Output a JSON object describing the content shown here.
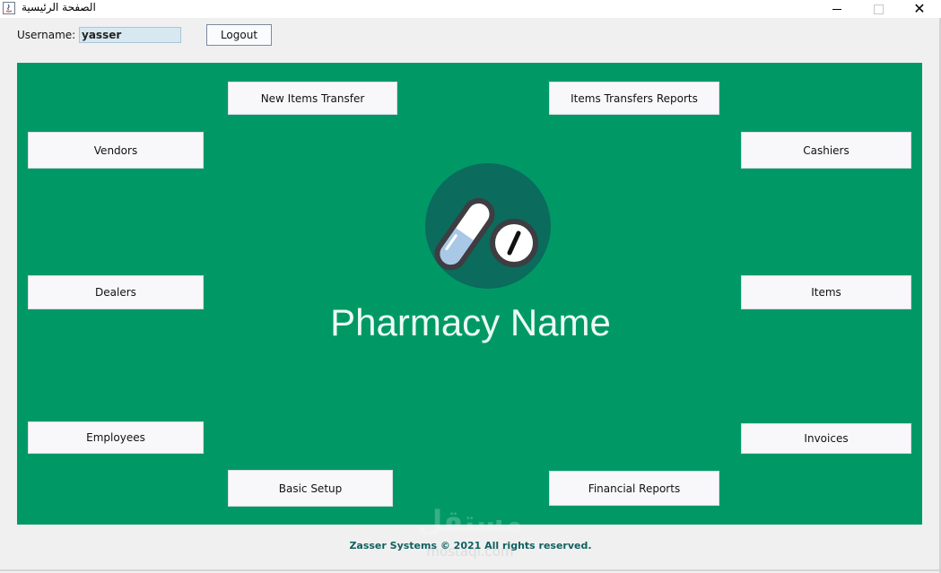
{
  "window": {
    "title": "الصفحة الرئيسية",
    "controls": {
      "minimize": "minimize-icon",
      "maximize": "maximize-icon",
      "close_glyph": "✕"
    }
  },
  "header": {
    "username_label": "Username:",
    "username_value": "yasser",
    "logout_label": "Logout"
  },
  "main": {
    "buttons": {
      "new_items_transfer": "New Items Transfer",
      "items_transfers_reports": "Items Transfers Reports",
      "vendors": "Vendors",
      "cashiers": "Cashiers",
      "dealers": "Dealers",
      "items": "Items",
      "employees": "Employees",
      "invoices": "Invoices",
      "basic_setup": "Basic Setup",
      "financial_reports": "Financial Reports"
    },
    "pharmacy_name": "Pharmacy Name",
    "logo_icon": "pills-icon"
  },
  "footer": {
    "text": "Zasser Systems © 2021 All rights reserved."
  },
  "watermark": {
    "arabic": "مستقل",
    "latin": "mostaql.com"
  },
  "colors": {
    "panel": "#009966",
    "logo_circle": "#0b6b5c",
    "footer_text": "#116060"
  }
}
